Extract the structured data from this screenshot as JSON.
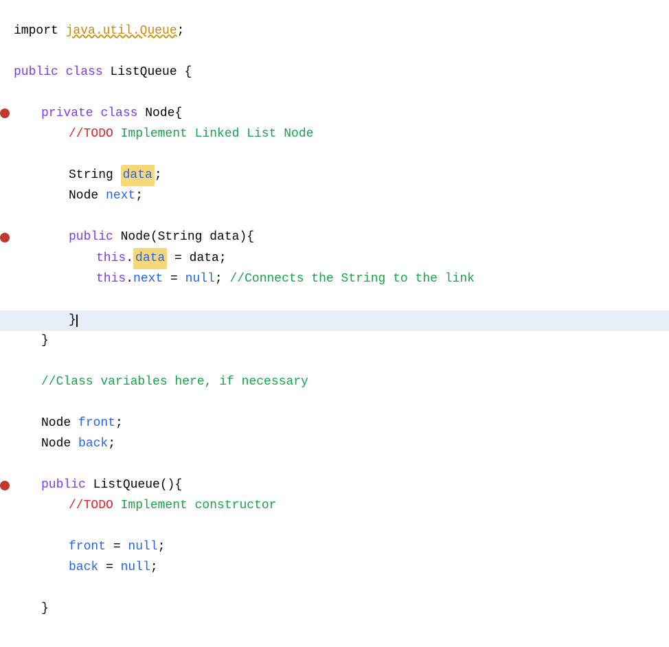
{
  "editor": {
    "background": "#ffffff",
    "lines": [
      {
        "id": 1,
        "indent": 0,
        "highlighted": false,
        "breakpoint": false,
        "tokens": [
          {
            "text": "import ",
            "class": "import-line"
          },
          {
            "text": "java.util.Queue",
            "class": "import-pkg"
          },
          {
            "text": ";",
            "class": "import-line"
          }
        ]
      },
      {
        "id": 2,
        "indent": 0,
        "highlighted": false,
        "breakpoint": false,
        "tokens": []
      },
      {
        "id": 3,
        "indent": 0,
        "highlighted": false,
        "breakpoint": false,
        "tokens": [
          {
            "text": "public",
            "class": "kw-purple"
          },
          {
            "text": " ",
            "class": ""
          },
          {
            "text": "class",
            "class": "kw-purple"
          },
          {
            "text": " ListQueue {",
            "class": "type-black"
          }
        ]
      },
      {
        "id": 4,
        "indent": 0,
        "highlighted": false,
        "breakpoint": false,
        "tokens": []
      },
      {
        "id": 5,
        "indent": 1,
        "highlighted": false,
        "breakpoint": true,
        "tokens": [
          {
            "text": "private",
            "class": "kw-purple"
          },
          {
            "text": " ",
            "class": ""
          },
          {
            "text": "class",
            "class": "kw-purple"
          },
          {
            "text": " Node{",
            "class": "type-black"
          }
        ]
      },
      {
        "id": 6,
        "indent": 2,
        "highlighted": false,
        "breakpoint": false,
        "tokens": [
          {
            "text": "//TODO",
            "class": "todo-kw"
          },
          {
            "text": " Implement Linked List Node",
            "class": "todo-text"
          }
        ]
      },
      {
        "id": 7,
        "indent": 0,
        "highlighted": false,
        "breakpoint": false,
        "tokens": []
      },
      {
        "id": 8,
        "indent": 2,
        "highlighted": false,
        "breakpoint": false,
        "tokens": [
          {
            "text": "String ",
            "class": "type-black"
          },
          {
            "text": "data",
            "class": "field-blue highlight-bg"
          },
          {
            "text": ";",
            "class": "type-black"
          }
        ]
      },
      {
        "id": 9,
        "indent": 2,
        "highlighted": false,
        "breakpoint": false,
        "tokens": [
          {
            "text": "Node ",
            "class": "type-black"
          },
          {
            "text": "next",
            "class": "field-blue"
          },
          {
            "text": ";",
            "class": "type-black"
          }
        ]
      },
      {
        "id": 10,
        "indent": 0,
        "highlighted": false,
        "breakpoint": false,
        "tokens": []
      },
      {
        "id": 11,
        "indent": 2,
        "highlighted": false,
        "breakpoint": true,
        "tokens": [
          {
            "text": "public",
            "class": "kw-purple"
          },
          {
            "text": " Node(",
            "class": "type-black"
          },
          {
            "text": "String",
            "class": "type-black"
          },
          {
            "text": " data){",
            "class": "type-black"
          }
        ]
      },
      {
        "id": 12,
        "indent": 3,
        "highlighted": false,
        "breakpoint": false,
        "tokens": [
          {
            "text": "this",
            "class": "kw-purple"
          },
          {
            "text": ".",
            "class": "type-black"
          },
          {
            "text": "data",
            "class": "field-blue highlight-bg"
          },
          {
            "text": " = data;",
            "class": "type-black"
          }
        ]
      },
      {
        "id": 13,
        "indent": 3,
        "highlighted": false,
        "breakpoint": false,
        "tokens": [
          {
            "text": "this",
            "class": "kw-purple"
          },
          {
            "text": ".",
            "class": "type-black"
          },
          {
            "text": "next",
            "class": "field-blue"
          },
          {
            "text": " = ",
            "class": "type-black"
          },
          {
            "text": "null",
            "class": "null-kw"
          },
          {
            "text": "; ",
            "class": "type-black"
          },
          {
            "text": "//Connects the String to the link",
            "class": "comment-green"
          }
        ]
      },
      {
        "id": 14,
        "indent": 0,
        "highlighted": false,
        "breakpoint": false,
        "tokens": []
      },
      {
        "id": 15,
        "indent": 2,
        "highlighted": true,
        "breakpoint": false,
        "tokens": [
          {
            "text": "}",
            "class": "type-black"
          },
          {
            "text": "|",
            "class": "cursor"
          }
        ]
      },
      {
        "id": 16,
        "indent": 1,
        "highlighted": false,
        "breakpoint": false,
        "tokens": [
          {
            "text": "}",
            "class": "type-black"
          }
        ]
      },
      {
        "id": 17,
        "indent": 0,
        "highlighted": false,
        "breakpoint": false,
        "tokens": []
      },
      {
        "id": 18,
        "indent": 1,
        "highlighted": false,
        "breakpoint": false,
        "tokens": [
          {
            "text": "//Class variables here, if necessary",
            "class": "comment-green"
          }
        ]
      },
      {
        "id": 19,
        "indent": 0,
        "highlighted": false,
        "breakpoint": false,
        "tokens": []
      },
      {
        "id": 20,
        "indent": 1,
        "highlighted": false,
        "breakpoint": false,
        "tokens": [
          {
            "text": "Node ",
            "class": "type-black"
          },
          {
            "text": "front",
            "class": "field-blue"
          },
          {
            "text": ";",
            "class": "type-black"
          }
        ]
      },
      {
        "id": 21,
        "indent": 1,
        "highlighted": false,
        "breakpoint": false,
        "tokens": [
          {
            "text": "Node ",
            "class": "type-black"
          },
          {
            "text": "back",
            "class": "field-blue"
          },
          {
            "text": ";",
            "class": "type-black"
          }
        ]
      },
      {
        "id": 22,
        "indent": 0,
        "highlighted": false,
        "breakpoint": false,
        "tokens": []
      },
      {
        "id": 23,
        "indent": 1,
        "highlighted": false,
        "breakpoint": true,
        "tokens": [
          {
            "text": "public",
            "class": "kw-purple"
          },
          {
            "text": " ListQueue(){",
            "class": "type-black"
          }
        ]
      },
      {
        "id": 24,
        "indent": 2,
        "highlighted": false,
        "breakpoint": false,
        "tokens": [
          {
            "text": "//TODO",
            "class": "todo-kw"
          },
          {
            "text": " Implement constructor",
            "class": "todo-text"
          }
        ]
      },
      {
        "id": 25,
        "indent": 0,
        "highlighted": false,
        "breakpoint": false,
        "tokens": []
      },
      {
        "id": 26,
        "indent": 2,
        "highlighted": false,
        "breakpoint": false,
        "tokens": [
          {
            "text": "front",
            "class": "field-blue"
          },
          {
            "text": " = ",
            "class": "type-black"
          },
          {
            "text": "null",
            "class": "null-kw"
          },
          {
            "text": ";",
            "class": "type-black"
          }
        ]
      },
      {
        "id": 27,
        "indent": 2,
        "highlighted": false,
        "breakpoint": false,
        "tokens": [
          {
            "text": "back",
            "class": "field-blue"
          },
          {
            "text": " = ",
            "class": "type-black"
          },
          {
            "text": "null",
            "class": "null-kw"
          },
          {
            "text": ";",
            "class": "type-black"
          }
        ]
      },
      {
        "id": 28,
        "indent": 0,
        "highlighted": false,
        "breakpoint": false,
        "tokens": []
      },
      {
        "id": 29,
        "indent": 1,
        "highlighted": false,
        "breakpoint": false,
        "tokens": [
          {
            "text": "}",
            "class": "type-black"
          }
        ]
      }
    ]
  }
}
